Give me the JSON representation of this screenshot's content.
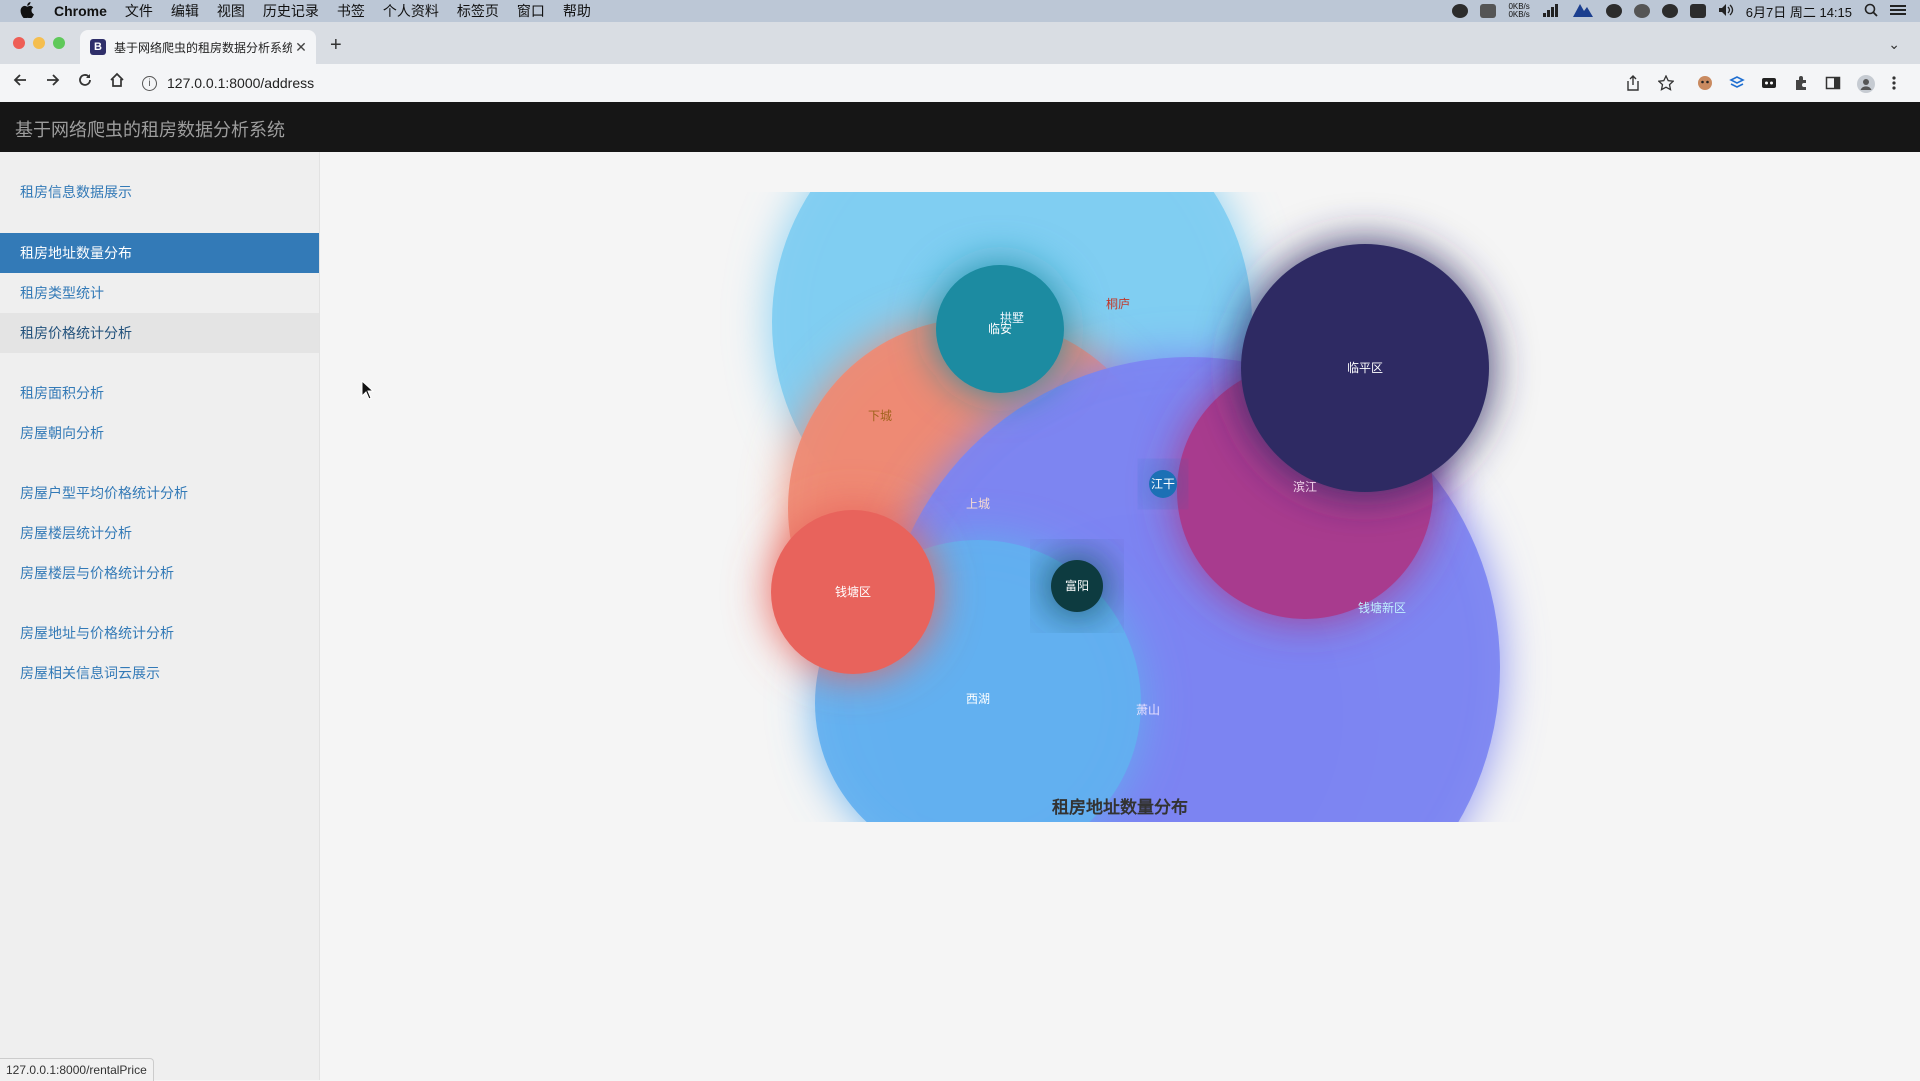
{
  "os_menubar": {
    "app_name": "Chrome",
    "menus": [
      "文件",
      "编辑",
      "视图",
      "历史记录",
      "书签",
      "个人资料",
      "标签页",
      "窗口",
      "帮助"
    ],
    "net_up": "0KB/s",
    "net_down": "0KB/s",
    "datetime": "6月7日 周二 14:15"
  },
  "browser": {
    "tab_title": "基于网络爬虫的租房数据分析系统",
    "tab_favicon": "B",
    "url": "127.0.0.1:8000/address",
    "status_url": "127.0.0.1:8000/rentalPrice"
  },
  "app": {
    "brand": "基于网络爬虫的租房数据分析系统"
  },
  "sidebar": {
    "items": [
      {
        "label": "租房信息数据展示",
        "state": "normal"
      },
      {
        "label": "租房地址数量分布",
        "state": "active"
      },
      {
        "label": "租房类型统计",
        "state": "normal"
      },
      {
        "label": "租房价格统计分析",
        "state": "hover"
      },
      {
        "label": "租房面积分析",
        "state": "normal"
      },
      {
        "label": "房屋朝向分析",
        "state": "normal"
      },
      {
        "label": "房屋户型平均价格统计分析",
        "state": "normal"
      },
      {
        "label": "房屋楼层统计分析",
        "state": "normal"
      },
      {
        "label": "房屋楼层与价格统计分析",
        "state": "normal"
      },
      {
        "label": "房屋地址与价格统计分析",
        "state": "normal"
      },
      {
        "label": "房屋相关信息词云展示",
        "state": "normal"
      }
    ]
  },
  "chart_data": {
    "type": "bubble",
    "title": "租房地址数量分布",
    "series": [
      {
        "name": "拱墅",
        "color": "#7fcdf2"
      },
      {
        "name": "上城",
        "color": "#ef8a73"
      },
      {
        "name": "萧山",
        "color": "#9e6bf2"
      },
      {
        "name": "钱塘新区",
        "color": "#7c84f2"
      },
      {
        "name": "西湖",
        "color": "#62b0f0"
      },
      {
        "name": "滨江",
        "color": "#a83b8e"
      },
      {
        "name": "临平区",
        "color": "#2e2a63"
      },
      {
        "name": "临安",
        "color": "#1a8ba1"
      },
      {
        "name": "钱塘区",
        "color": "#e8635b"
      },
      {
        "name": "富阳",
        "color": "#0e3a3f"
      },
      {
        "name": "江干",
        "color": "#1a6fb5"
      },
      {
        "name": "桐庐",
        "color": "#d9534f"
      },
      {
        "name": "下城",
        "color": "#e8b04a"
      }
    ]
  }
}
